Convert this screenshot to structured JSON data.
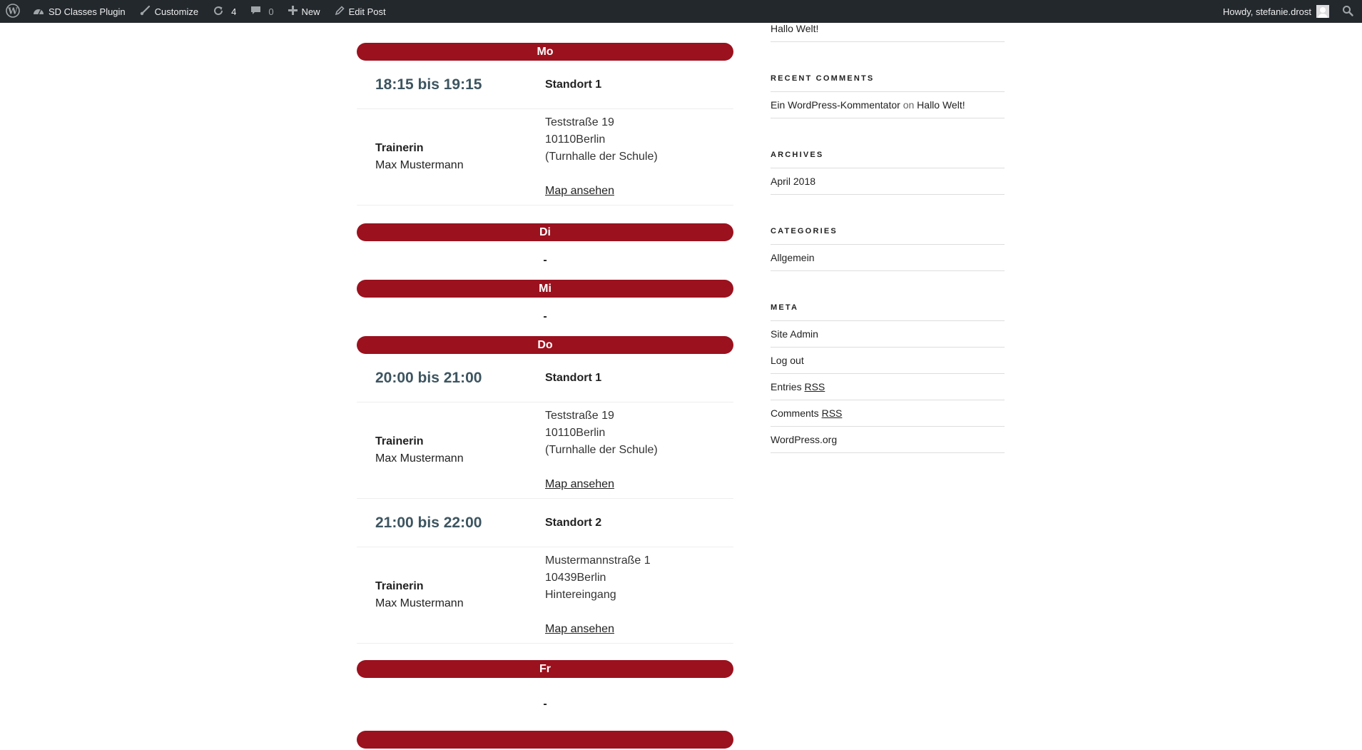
{
  "adminbar": {
    "site_name": "SD Classes Plugin",
    "customize": "Customize",
    "updates_count": "4",
    "comments_count": "0",
    "new_label": "New",
    "edit_post": "Edit Post",
    "howdy": "Howdy, stefanie.drost"
  },
  "schedule": {
    "days": [
      {
        "label": "Mo",
        "sessions": [
          {
            "time": "18:15 bis 19:15",
            "location": "Standort 1",
            "trainer_label": "Trainerin",
            "trainer_name": "Max Mustermann",
            "address_line1": "Teststraße 19",
            "address_line2": "10110Berlin",
            "address_line3": "(Turnhalle der Schule)",
            "map_link": "Map ansehen"
          }
        ]
      },
      {
        "label": "Di",
        "empty": "-"
      },
      {
        "label": "Mi",
        "empty": "-"
      },
      {
        "label": "Do",
        "sessions": [
          {
            "time": "20:00 bis 21:00",
            "location": "Standort 1",
            "trainer_label": "Trainerin",
            "trainer_name": "Max Mustermann",
            "address_line1": "Teststraße 19",
            "address_line2": "10110Berlin",
            "address_line3": "(Turnhalle der Schule)",
            "map_link": "Map ansehen"
          },
          {
            "time": "21:00 bis 22:00",
            "location": "Standort 2",
            "trainer_label": "Trainerin",
            "trainer_name": "Max Mustermann",
            "address_line1": "Mustermannstraße 1",
            "address_line2": "10439Berlin",
            "address_line3": "Hintereingang",
            "map_link": "Map ansehen"
          }
        ]
      },
      {
        "label": "Fr",
        "empty": "-"
      }
    ]
  },
  "sidebar": {
    "top_post": "Hallo Welt!",
    "recent_comments": {
      "title": "Recent Comments",
      "author": "Ein WordPress-Kommentator",
      "on": "on",
      "post": "Hallo Welt!"
    },
    "archives": {
      "title": "Archives",
      "items": [
        "April 2018"
      ]
    },
    "categories": {
      "title": "Categories",
      "items": [
        "Allgemein"
      ]
    },
    "meta": {
      "title": "Meta",
      "site_admin": "Site Admin",
      "log_out": "Log out",
      "entries_prefix": "Entries",
      "comments_prefix": "Comments",
      "rss": "RSS",
      "wordpress_org": "WordPress.org"
    }
  },
  "colors": {
    "accent": "#9b111e",
    "adminbar_bg": "#23282d",
    "time_text": "#3d5560"
  }
}
